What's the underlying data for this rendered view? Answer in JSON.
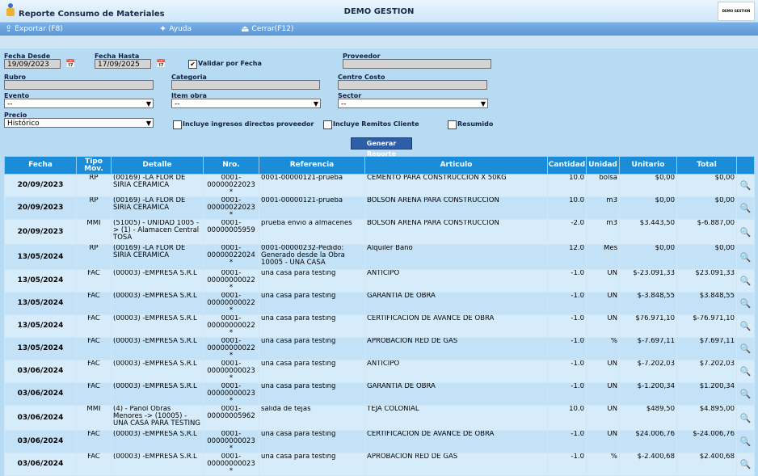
{
  "header": {
    "title": "Reporte Consumo de Materiales",
    "company": "DEMO GESTION",
    "logo_text": "DEMO GESTION"
  },
  "toolbar": {
    "export": "Exportar (F8)",
    "help": "Ayuda",
    "close": "Cerrar(F12)"
  },
  "filters": {
    "fecha_desde_label": "Fecha Desde",
    "fecha_desde": "19/09/2023",
    "fecha_hasta_label": "Fecha Hasta",
    "fecha_hasta": "17/09/2025",
    "validar_label": "Validar por Fecha",
    "validar_checked": true,
    "proveedor_label": "Proveedor",
    "proveedor": "",
    "rubro_label": "Rubro",
    "rubro": "",
    "categoria_label": "Categoria",
    "categoria": "",
    "centro_costo_label": "Centro Costo",
    "centro_costo": "",
    "evento_label": "Evento",
    "evento": "--",
    "item_obra_label": "Item obra",
    "item_obra": "--",
    "sector_label": "Sector",
    "sector": "--",
    "precio_label": "Precio",
    "precio": "Histórico",
    "incluye_ingresos": "Incluye ingresos directos proveedor",
    "incluye_remitos": "Incluye Remitos Cliente",
    "resumido": "Resumido",
    "generar": "Generar Reporte"
  },
  "table": {
    "headers": [
      "Fecha",
      "Tipo Mov.",
      "Detalle",
      "Nro.",
      "Referencia",
      "Articulo",
      "Cantidad",
      "Unidad",
      "Unitario",
      "Total"
    ],
    "rows": [
      {
        "fecha": "20/09/2023",
        "tipo": "RP",
        "detalle": "(00169) -LA FLOR DE SIRIA CERAMICA",
        "nro": "0001-00000022023 *",
        "ref": "0001-00000121-prueba",
        "art": "CEMENTO PARA CONSTRUCCION X 50KG",
        "cant": "10.0",
        "uni": "bolsa",
        "unit": "$0,00",
        "total": "$0,00"
      },
      {
        "fecha": "20/09/2023",
        "tipo": "RP",
        "detalle": "(00169) -LA FLOR DE SIRIA CERAMICA",
        "nro": "0001-00000022023 *",
        "ref": "0001-00000121-prueba",
        "art": "BOLSON ARENA PARA CONSTRUCCION",
        "cant": "10.0",
        "uni": "m3",
        "unit": "$0,00",
        "total": "$0,00"
      },
      {
        "fecha": "20/09/2023",
        "tipo": "MMI",
        "detalle": "(51005) - UNIDAD 1005 -> (1) - Alamacen Central TOSA",
        "nro": "0001-00000005959",
        "ref": "prueba envio a almacenes",
        "art": "BOLSON ARENA PARA CONSTRUCCION",
        "cant": "-2.0",
        "uni": "m3",
        "unit": "$3.443,50",
        "total": "$-6.887,00"
      },
      {
        "fecha": "13/05/2024",
        "tipo": "RP",
        "detalle": "(00169) -LA FLOR DE SIRIA CERAMICA",
        "nro": "0001-00000022024 *",
        "ref": "0001-00000232-Pedido: Generado desde la Obra 10005 - UNA CASA",
        "art": "Alquiler Baño",
        "cant": "12.0",
        "uni": "Mes",
        "unit": "$0,00",
        "total": "$0,00"
      },
      {
        "fecha": "13/05/2024",
        "tipo": "FAC",
        "detalle": "(00003) -EMPRESA S.R.L",
        "nro": "0001-00000000022 *",
        "ref": "una casa para testing",
        "art": "ANTICIPO",
        "cant": "-1.0",
        "uni": "UN",
        "unit": "$-23.091,33",
        "total": "$23.091,33"
      },
      {
        "fecha": "13/05/2024",
        "tipo": "FAC",
        "detalle": "(00003) -EMPRESA S.R.L",
        "nro": "0001-00000000022 *",
        "ref": "una casa para testing",
        "art": "GARANTIA DE OBRA",
        "cant": "-1.0",
        "uni": "UN",
        "unit": "$-3.848,55",
        "total": "$3.848,55"
      },
      {
        "fecha": "13/05/2024",
        "tipo": "FAC",
        "detalle": "(00003) -EMPRESA S.R.L",
        "nro": "0001-00000000022 *",
        "ref": "una casa para testing",
        "art": "CERTIFICACION DE AVANCE DE OBRA",
        "cant": "-1.0",
        "uni": "UN",
        "unit": "$76.971,10",
        "total": "$-76.971,10"
      },
      {
        "fecha": "13/05/2024",
        "tipo": "FAC",
        "detalle": "(00003) -EMPRESA S.R.L",
        "nro": "0001-00000000022 *",
        "ref": "una casa para testing",
        "art": "APROBACION RED DE GAS",
        "cant": "-1.0",
        "uni": "%",
        "unit": "$-7.697,11",
        "total": "$7.697,11"
      },
      {
        "fecha": "03/06/2024",
        "tipo": "FAC",
        "detalle": "(00003) -EMPRESA S.R.L",
        "nro": "0001-00000000023 *",
        "ref": "una casa para testing",
        "art": "ANTICIPO",
        "cant": "-1.0",
        "uni": "UN",
        "unit": "$-7.202,03",
        "total": "$7.202,03"
      },
      {
        "fecha": "03/06/2024",
        "tipo": "FAC",
        "detalle": "(00003) -EMPRESA S.R.L",
        "nro": "0001-00000000023 *",
        "ref": "una casa para testing",
        "art": "GARANTIA DE OBRA",
        "cant": "-1.0",
        "uni": "UN",
        "unit": "$-1.200,34",
        "total": "$1.200,34"
      },
      {
        "fecha": "03/06/2024",
        "tipo": "MMI",
        "detalle": "(4) - Pañol Obras Menores -> (10005) - UNA CASA PARA TESTING",
        "nro": "0001-00000005962",
        "ref": "salida de tejas",
        "art": "TEJA COLONIAL",
        "cant": "10.0",
        "uni": "UN",
        "unit": "$489,50",
        "total": "$4.895,00"
      },
      {
        "fecha": "03/06/2024",
        "tipo": "FAC",
        "detalle": "(00003) -EMPRESA S.R.L",
        "nro": "0001-00000000023 *",
        "ref": "una casa para testing",
        "art": "CERTIFICACION DE AVANCE DE OBRA",
        "cant": "-1.0",
        "uni": "UN",
        "unit": "$24.006,76",
        "total": "$-24.006,76"
      },
      {
        "fecha": "03/06/2024",
        "tipo": "FAC",
        "detalle": "(00003) -EMPRESA S.R.L",
        "nro": "0001-00000000023 *",
        "ref": "una casa para testing",
        "art": "APROBACION RED DE GAS",
        "cant": "-1.0",
        "uni": "%",
        "unit": "$-2.400,68",
        "total": "$2.400,68"
      }
    ]
  }
}
